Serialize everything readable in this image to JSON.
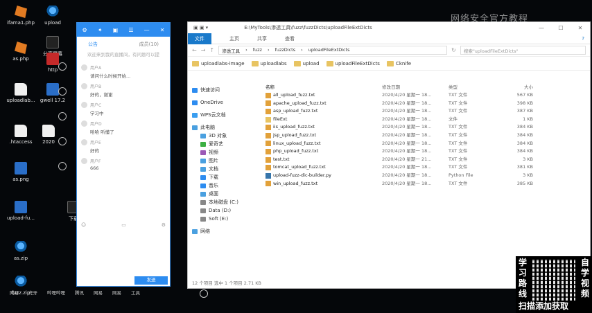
{
  "desktop": {
    "icons": [
      {
        "label": "ifama1.php",
        "kind": "php"
      },
      {
        "label": "upload",
        "kind": "zip"
      },
      {
        "label": "as.php",
        "kind": "php"
      },
      {
        "label": "分享屏幕",
        "kind": "share"
      },
      {
        "label": "http",
        "kind": "red"
      },
      {
        "label": "uploadlab...",
        "kind": "file"
      },
      {
        "label": "gwell 17.2",
        "kind": "dark"
      },
      {
        "label": ".htaccess",
        "kind": "file"
      },
      {
        "label": "2020",
        "kind": "file"
      },
      {
        "label": "as.png",
        "kind": "dark"
      },
      {
        "label": "upload-fu...",
        "kind": "dark"
      },
      {
        "label": "下载",
        "kind": "share"
      },
      {
        "label": "as.zip",
        "kind": "zip"
      },
      {
        "label": "fuzz.zip",
        "kind": "zip"
      }
    ],
    "watermark": "网络安全官方教程",
    "promo": {
      "left": "学习路线",
      "right": "自学视频",
      "caption": "扫描添加获取"
    }
  },
  "taskbar": [
    "网易",
    "虎牙",
    "哔哩哔哩",
    "腾讯",
    "网易",
    "网易",
    "工具"
  ],
  "chat": {
    "tabs": [
      "公告",
      "成员(10)"
    ],
    "notice": "欢迎来到我的直播间，有问题可以提",
    "messages": [
      {
        "who": "用户A",
        "text": "请问什么时候开始..."
      },
      {
        "who": "用户B",
        "text": "好的，谢谢"
      },
      {
        "who": "用户C",
        "text": "学习中"
      },
      {
        "who": "用户D",
        "text": "哈哈 听懂了"
      },
      {
        "who": "用户E",
        "text": "好的"
      },
      {
        "who": "用户F",
        "text": "666"
      }
    ],
    "send": "发送"
  },
  "explorer": {
    "title_path": "E:\\MyTools\\渗透工具\\fuzz\\fuzzDicts\\uploadFileExtDicts",
    "ribbon": {
      "file": "文件",
      "tabs": [
        "主页",
        "共享",
        "查看"
      ]
    },
    "breadcrumb": [
      "渗透工具",
      "fuzz",
      "fuzzDicts",
      "uploadFileExtDicts"
    ],
    "search_placeholder": "搜索\"uploadFileExtDicts\"",
    "quick": [
      "uploadlabs-image",
      "uploadlabs",
      "upload",
      "uploadFileExtDicts",
      "Cknife"
    ],
    "nav": [
      {
        "label": "快速访问",
        "color": "#2d8cf0"
      },
      {
        "gap": true
      },
      {
        "label": "OneDrive",
        "color": "#2d8cf0"
      },
      {
        "gap": true
      },
      {
        "label": "WPS云文档",
        "color": "#3a9ef0"
      },
      {
        "gap": true
      },
      {
        "label": "此电脑",
        "color": "#4aa0e0"
      },
      {
        "label": "3D 对象",
        "color": "#4aa0e0"
      },
      {
        "label": "爱奇艺",
        "color": "#3cb043"
      },
      {
        "label": "视频",
        "color": "#9b59b6"
      },
      {
        "label": "图片",
        "color": "#4aa0e0"
      },
      {
        "label": "文档",
        "color": "#4aa0e0"
      },
      {
        "label": "下载",
        "color": "#2d8cf0"
      },
      {
        "label": "音乐",
        "color": "#2d8cf0"
      },
      {
        "label": "桌面",
        "color": "#4aa0e0"
      },
      {
        "label": "本地磁盘 (C:)",
        "color": "#888"
      },
      {
        "label": "Data (D:)",
        "color": "#888"
      },
      {
        "label": "Soft (E:)",
        "color": "#888"
      },
      {
        "gap": true
      },
      {
        "label": "网络",
        "color": "#4aa0e0"
      }
    ],
    "columns": [
      "名称",
      "修改日期",
      "类型",
      "大小"
    ],
    "files": [
      {
        "name": "all_upload_fuzz.txt",
        "date": "2020/4/20 星期一 18...",
        "type": "TXT 文件",
        "size": "567 KB",
        "kind": "txt"
      },
      {
        "name": "apache_upload_fuzz.txt",
        "date": "2020/4/20 星期一 18...",
        "type": "TXT 文件",
        "size": "398 KB",
        "kind": "txt"
      },
      {
        "name": "asp_upload_fuzz.txt",
        "date": "2020/4/20 星期一 18...",
        "type": "TXT 文件",
        "size": "387 KB",
        "kind": "txt"
      },
      {
        "name": "fileExt",
        "date": "2020/4/20 星期一 18...",
        "type": "文件",
        "size": "1 KB",
        "kind": "dir"
      },
      {
        "name": "iis_upload_fuzz.txt",
        "date": "2020/4/20 星期一 18...",
        "type": "TXT 文件",
        "size": "384 KB",
        "kind": "txt"
      },
      {
        "name": "jsp_upload_fuzz.txt",
        "date": "2020/4/20 星期一 18...",
        "type": "TXT 文件",
        "size": "384 KB",
        "kind": "txt"
      },
      {
        "name": "linux_upload_fuzz.txt",
        "date": "2020/4/20 星期一 18...",
        "type": "TXT 文件",
        "size": "384 KB",
        "kind": "txt"
      },
      {
        "name": "php_upload_fuzz.txt",
        "date": "2020/4/20 星期一 18...",
        "type": "TXT 文件",
        "size": "384 KB",
        "kind": "txt"
      },
      {
        "name": "test.txt",
        "date": "2020/4/20 星期一 21...",
        "type": "TXT 文件",
        "size": "3 KB",
        "kind": "txt"
      },
      {
        "name": "tomcat_upload_fuzz.txt",
        "date": "2020/4/20 星期一 18...",
        "type": "TXT 文件",
        "size": "381 KB",
        "kind": "txt"
      },
      {
        "name": "upload-fuzz-dic-builder.py",
        "date": "2020/4/20 星期一 18...",
        "type": "Python File",
        "size": "3 KB",
        "kind": "py"
      },
      {
        "name": "win_upload_fuzz.txt",
        "date": "2020/4/20 星期一 18...",
        "type": "TXT 文件",
        "size": "385 KB",
        "kind": "txt"
      }
    ],
    "status": "12 个项目   选中 1 个项目  2.71 KB"
  }
}
